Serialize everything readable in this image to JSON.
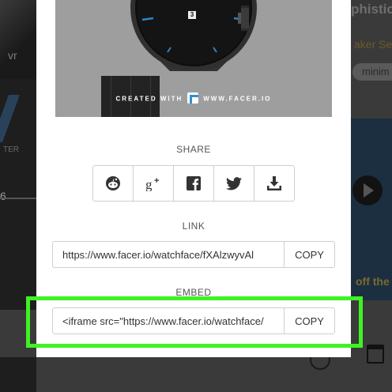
{
  "background": {
    "left_text_v": "vr",
    "left_text_ter": "TER",
    "left_text_6": "6",
    "right_title": "phistic",
    "right_subtitle": "aker Se",
    "right_pill": "minim",
    "right_banner": "off the"
  },
  "preview": {
    "watch_date": "3",
    "credit_left": "CREATED WITH",
    "credit_right": "WWW.FACER.IO"
  },
  "share": {
    "label": "SHARE",
    "buttons": [
      {
        "icon": "reddit-icon"
      },
      {
        "icon": "google-plus-icon"
      },
      {
        "icon": "facebook-icon"
      },
      {
        "icon": "twitter-icon"
      },
      {
        "icon": "download-icon"
      }
    ]
  },
  "link": {
    "label": "LINK",
    "value": "https://www.facer.io/watchface/fXAlzwyvAl",
    "copy_label": "COPY"
  },
  "embed": {
    "label": "EMBED",
    "value": "<iframe src=\"https://www.facer.io/watchface/",
    "copy_label": "COPY"
  },
  "colors": {
    "highlight": "#3ff224",
    "facer_blue": "#2f8fd0"
  }
}
